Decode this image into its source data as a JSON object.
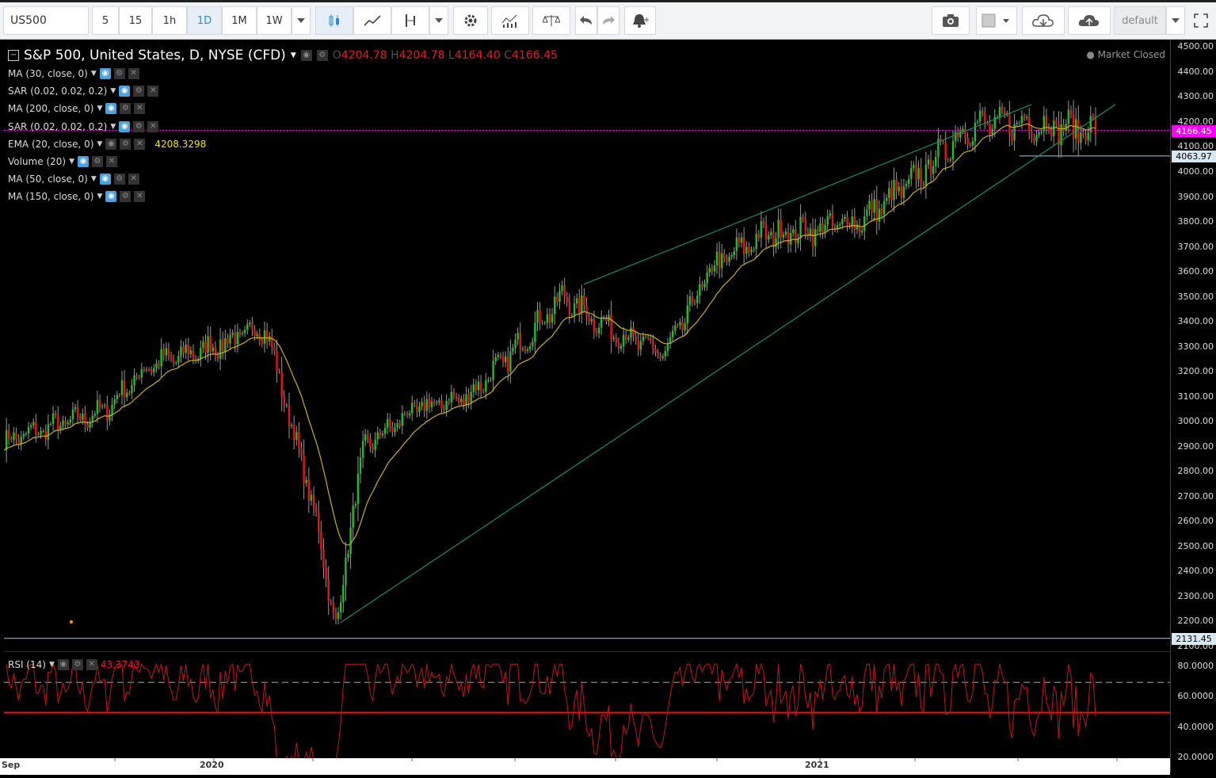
{
  "toolbar": {
    "symbol": "US500",
    "intervals": [
      "5",
      "15",
      "1h",
      "1D",
      "1M",
      "1W"
    ],
    "selected_interval": "1D",
    "layout_name": "default",
    "icons": [
      "candles-icon",
      "line-chart-icon",
      "indicators-icon",
      "dropdown-icon",
      "settings-icon",
      "studies-icon",
      "compare-icon",
      "undo-icon",
      "redo-icon",
      "alert-icon",
      "camera-icon",
      "color-icon",
      "cloud-load-icon",
      "cloud-save-icon",
      "fullscreen-icon"
    ]
  },
  "chart": {
    "title": "S&P 500, United States, D, NYSE (CFD)",
    "ohlc": {
      "o_label": "O",
      "o": "4204.78",
      "h_label": "H",
      "h": "4204.78",
      "l_label": "L",
      "l": "4164.40",
      "c_label": "C",
      "c": "4166.45"
    },
    "market_status": "Market Closed",
    "indicators": [
      {
        "label": "MA (30, close, 0)",
        "value": ""
      },
      {
        "label": "SAR (0.02, 0.02, 0.2)",
        "value": ""
      },
      {
        "label": "MA (200, close, 0)",
        "value": ""
      },
      {
        "label": "SAR (0.02, 0.02, 0.2)",
        "value": ""
      },
      {
        "label": "EMA (20, close, 0)",
        "value": "4208.3298"
      },
      {
        "label": "Volume (20)",
        "value": ""
      },
      {
        "label": "MA (50, close, 0)",
        "value": ""
      },
      {
        "label": "MA (150, close, 0)",
        "value": ""
      }
    ],
    "price_tags": {
      "last": "4166.45",
      "support": "4063.97",
      "low": "2131.45"
    },
    "colors": {
      "up": "#22c022",
      "down": "#e01818",
      "ema": "#c8b020",
      "trendline": "#1a8f6a",
      "last_price": "#ff00ff",
      "rsi": "#c01818"
    }
  },
  "rsi": {
    "label": "RSI (14)",
    "value": "43.3743",
    "levels": [
      "80.0000",
      "60.0000",
      "40.0000",
      "20.0000"
    ]
  },
  "time_axis": {
    "labels": [
      "Sep",
      "2020",
      "2021"
    ]
  },
  "chart_data": {
    "type": "candlestick",
    "symbol": "S&P 500",
    "yaxis_ticks": [
      4500,
      4400,
      4300,
      4200,
      4100,
      4000,
      3900,
      3800,
      3700,
      3600,
      3500,
      3400,
      3300,
      3200,
      3100,
      3000,
      2900,
      2800,
      2700,
      2600,
      2500,
      2400,
      2300,
      2200,
      2100
    ],
    "ylim": [
      2080,
      4530
    ],
    "close_path": [
      {
        "x": "2019-09",
        "y": 2920
      },
      {
        "x": "2019-10",
        "y": 2980
      },
      {
        "x": "2019-11",
        "y": 3040
      },
      {
        "x": "2019-12",
        "y": 3230
      },
      {
        "x": "2020-01",
        "y": 3290
      },
      {
        "x": "2020-02",
        "y": 3380
      },
      {
        "x": "2020-03",
        "y": 2300
      },
      {
        "x": "2020-04",
        "y": 2900
      },
      {
        "x": "2020-05",
        "y": 3050
      },
      {
        "x": "2020-06",
        "y": 3100
      },
      {
        "x": "2020-07",
        "y": 3270
      },
      {
        "x": "2020-08",
        "y": 3500
      },
      {
        "x": "2020-09",
        "y": 3360
      },
      {
        "x": "2020-10",
        "y": 3270
      },
      {
        "x": "2020-11",
        "y": 3620
      },
      {
        "x": "2020-12",
        "y": 3750
      },
      {
        "x": "2021-01",
        "y": 3770
      },
      {
        "x": "2021-02",
        "y": 3810
      },
      {
        "x": "2021-03",
        "y": 3970
      },
      {
        "x": "2021-04",
        "y": 4180
      },
      {
        "x": "2021-05",
        "y": 4200
      },
      {
        "x": "2021-06",
        "y": 4166.45
      }
    ],
    "rsi_ylim": [
      10,
      90
    ],
    "rsi_levels": [
      70,
      50
    ]
  }
}
